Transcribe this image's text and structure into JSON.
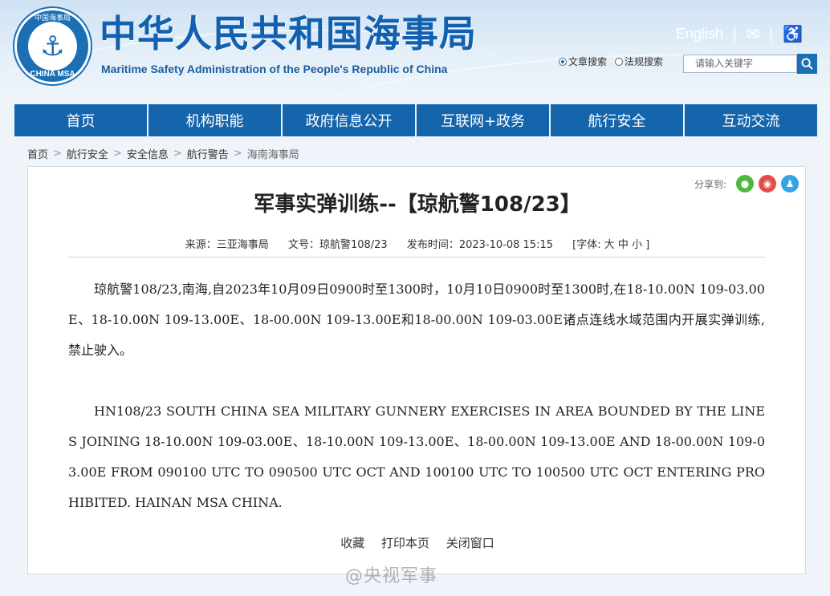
{
  "header": {
    "logo_top_text": "中国海事局",
    "logo_bottom_text": "CHINA MSA",
    "site_title": "中华人民共和国海事局",
    "site_subtitle": "Maritime Safety Administration of the People's Republic of China",
    "english_link": "English",
    "separator": "|",
    "mail_icon": "mail-icon",
    "accessibility_icon": "accessibility-icon",
    "search_options": [
      "文章搜索",
      "法规搜索"
    ],
    "search_selected": "文章搜索",
    "search_placeholder": "请输入关键字",
    "search_icon": "search-icon"
  },
  "nav": {
    "items": [
      "首页",
      "机构职能",
      "政府信息公开",
      "互联网+政务",
      "航行安全",
      "互动交流"
    ]
  },
  "breadcrumb": {
    "items": [
      "首页",
      "航行安全",
      "安全信息",
      "航行警告",
      "海南海事局"
    ],
    "separator": ">"
  },
  "article": {
    "share_label": "分享到:",
    "title": "军事实弹训练--【琼航警108/23】",
    "meta": {
      "source": "来源：三亚海事局",
      "doc_no": "文号：琼航警108/23",
      "publish_time": "发布时间：2023-10-08 15:15",
      "font_size": "[字体:  大  中  小 ]"
    },
    "paragraphs": [
      "琼航警108/23,南海,自2023年10月09日0900时至1300时，10月10日0900时至1300时,在18-10.00N 109-03.00E、18-10.00N 109-13.00E、18-00.00N 109-13.00E和18-00.00N 109-03.00E诸点连线水域范围内开展实弹训练,禁止驶入。",
      "HN108/23    SOUTH CHINA SEA    MILITARY GUNNERY EXERCISES    IN AREA BOUNDED BY THE LINES JOINING 18-10.00N 109-03.00E、18-10.00N 109-13.00E、18-00.00N 109-13.00E    AND 18-00.00N 109-03.00E FROM 090100    UTC    TO 090500    UTC OCT AND 100100 UTC TO 100500 UTC OCT ENTERING PROHIBITED. HAINAN MSA CHINA."
    ],
    "actions": [
      "收藏",
      "打印本页",
      "关闭窗口"
    ]
  },
  "watermark": "@央视军事",
  "colors": {
    "brand_blue": "#1565ad",
    "title_blue": "#1161b0"
  }
}
